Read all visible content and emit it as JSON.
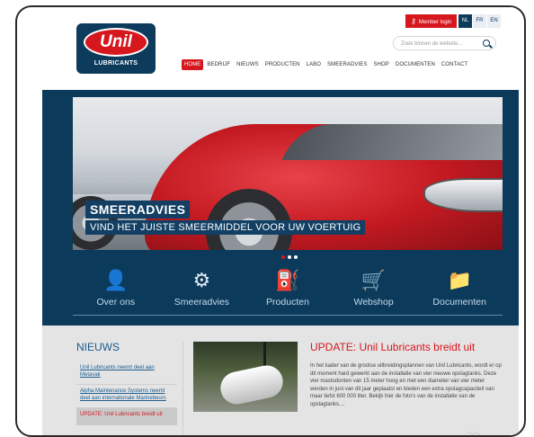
{
  "header": {
    "logo_text": "Unil",
    "logo_sub": "LUBRICANTS",
    "member_login": "Member login",
    "languages": [
      "NL",
      "FR",
      "EN"
    ],
    "search_placeholder": "Zoek binnen de website...",
    "nav": [
      "HOME",
      "BEDRIJF",
      "NIEUWS",
      "PRODUCTEN",
      "LABO",
      "SMEERADVIES",
      "SHOP",
      "DOCUMENTEN",
      "CONTACT"
    ]
  },
  "hero": {
    "title": "SMEERADVIES",
    "subtitle": "VIND HET JUISTE SMEERMIDDEL VOOR UW VOERTUIG"
  },
  "quick_links": [
    {
      "label": "Over ons",
      "icon": "person-icon"
    },
    {
      "label": "Smeeradvies",
      "icon": "gears-icon"
    },
    {
      "label": "Producten",
      "icon": "oil-can-icon"
    },
    {
      "label": "Webshop",
      "icon": "cart-icon"
    },
    {
      "label": "Documenten",
      "icon": "folder-icon"
    }
  ],
  "news": {
    "heading": "NIEUWS",
    "links": [
      "Unil Lubricants neemt deel aan Metavak",
      "Alpha Maintenance Systems neemt deel aan internationale Marinebeurs",
      "UPDATE: Unil Lubricants breidt uit"
    ],
    "article_title": "UPDATE: Unil Lubricants breidt uit",
    "article_body": "In het kader van de grootse uitbreidingsplannen van Unil Lubricants, wordt er op dit moment hard gewerkt aan de installatie van vier nieuwe opslagtanks. Deze vier mastodonten van 15 meter hoog en met een diameter van vier meter werden in juni van dit jaar geplaatst en bieden een extra opslagcapaciteit van maar liefst 600 000 liter. Bekijk hier de foto's van de installatie van de opslagtanks....",
    "more": ">>"
  },
  "colors": {
    "brand_blue": "#0b3a5b",
    "accent_red": "#d6171e"
  }
}
